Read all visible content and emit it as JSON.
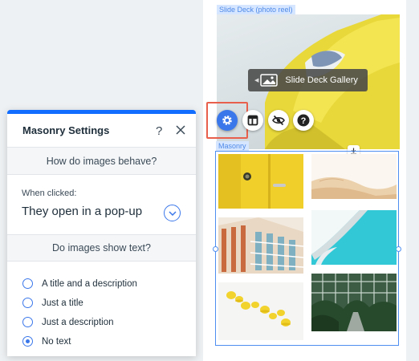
{
  "canvas": {
    "slide_deck_tag": "Slide Deck (photo reel)",
    "gallery_chip_label": "Slide Deck Gallery",
    "masonry_tag": "Masonry"
  },
  "toolbar": {
    "buttons": [
      {
        "name": "settings-button",
        "icon": "gear-icon"
      },
      {
        "name": "layout-button",
        "icon": "layout-icon"
      },
      {
        "name": "hide-button",
        "icon": "eye-off-icon"
      },
      {
        "name": "help-button",
        "icon": "question-icon"
      }
    ]
  },
  "panel": {
    "title": "Masonry Settings",
    "help_glyph": "?",
    "behave_heading": "How do images behave?",
    "when_clicked_label": "When clicked:",
    "when_clicked_value": "They open in a pop-up",
    "text_heading": "Do images show text?",
    "options": [
      {
        "label": "A title and a description",
        "checked": false
      },
      {
        "label": "Just a title",
        "checked": false
      },
      {
        "label": "Just a description",
        "checked": false
      },
      {
        "label": "No text",
        "checked": true
      }
    ]
  },
  "colors": {
    "accent": "#3a77ea",
    "highlight": "#e8604c",
    "panel_top_bar": "#116dff",
    "selection": "#4e8ef0"
  }
}
